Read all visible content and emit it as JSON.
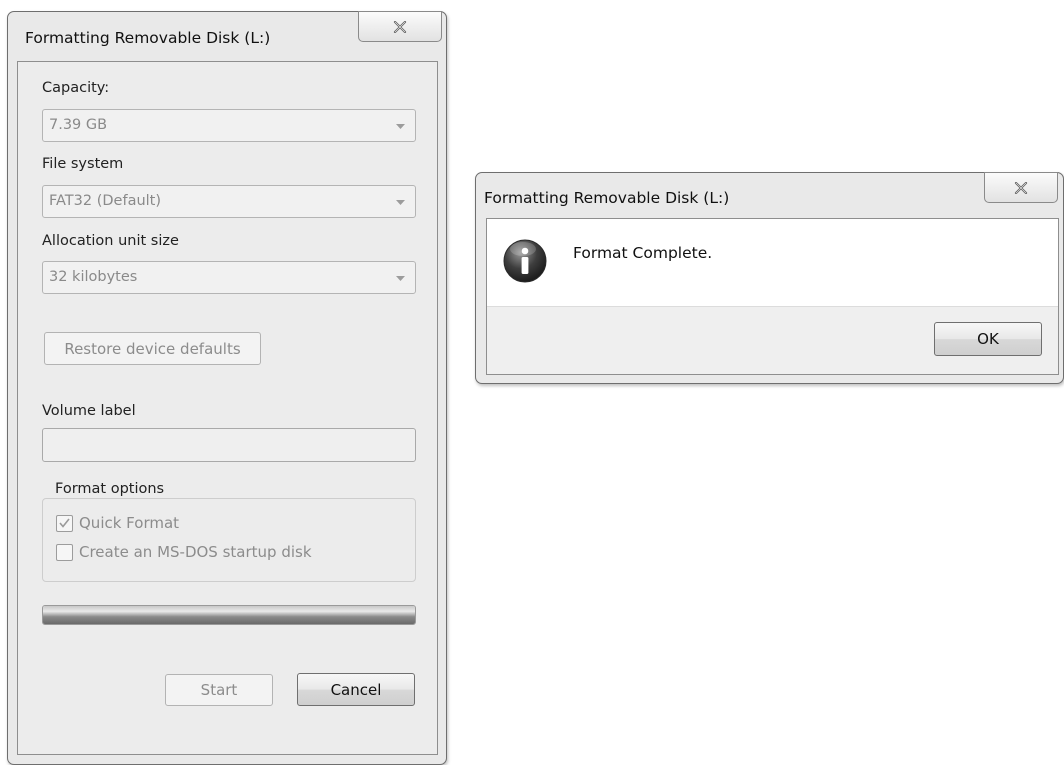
{
  "format_dialog": {
    "title": "Formatting Removable Disk (L:)",
    "capacity": {
      "label": "Capacity:",
      "value": "7.39 GB"
    },
    "file_system": {
      "label": "File system",
      "value": "FAT32 (Default)"
    },
    "allocation": {
      "label": "Allocation unit size",
      "value": "32 kilobytes"
    },
    "restore_label": "Restore device defaults",
    "volume_label": {
      "label": "Volume label",
      "value": ""
    },
    "format_options": {
      "legend": "Format options",
      "quick_format": {
        "label": "Quick Format",
        "checked": true,
        "enabled": false
      },
      "msdos_disk": {
        "label": "Create an MS-DOS startup disk",
        "checked": false,
        "enabled": false
      }
    },
    "progress_percent": 100,
    "start_label": "Start",
    "cancel_label": "Cancel"
  },
  "complete_dialog": {
    "title": "Formatting Removable Disk (L:)",
    "message": "Format Complete.",
    "ok_label": "OK"
  },
  "icons": {
    "close": "close-icon",
    "info": "info-icon",
    "dropdown": "chevron-down-icon",
    "check": "checkmark-icon"
  }
}
